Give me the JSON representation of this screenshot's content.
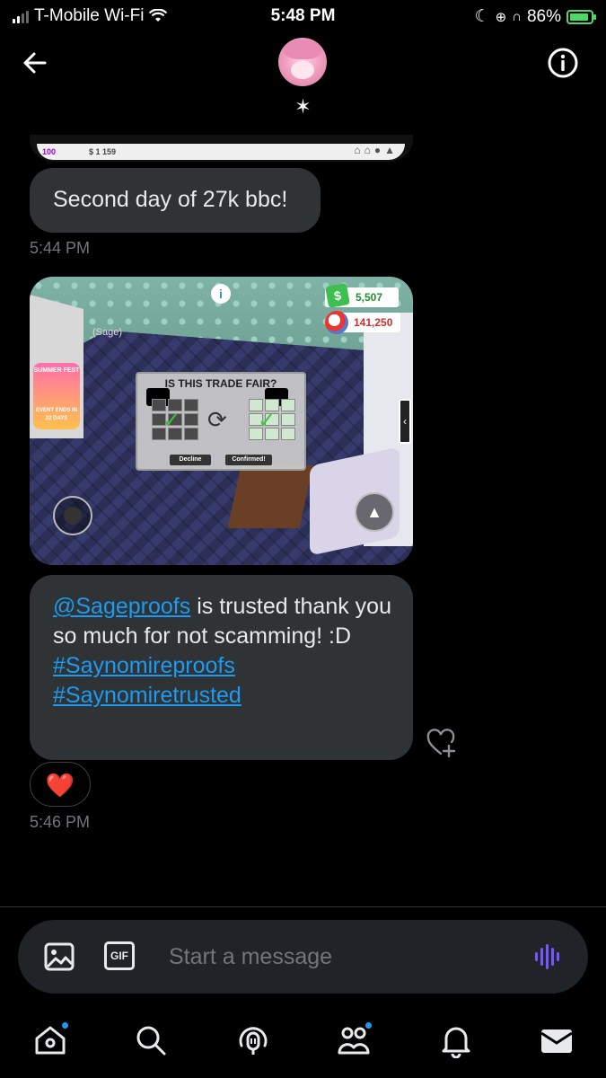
{
  "status_bar": {
    "carrier": "T-Mobile Wi-Fi",
    "time": "5:48 PM",
    "battery": "86%"
  },
  "header": {
    "star_symbol": "✶"
  },
  "top_image": {
    "text_left": "100",
    "text_price": "$ 1 159"
  },
  "messages": [
    {
      "text": "Second day of 27k bbc!",
      "time": "5:44 PM"
    },
    {
      "image": {
        "money": "5,507",
        "bucks": "141,250",
        "player_name": "(Sage)",
        "event_badge": "SUMMER FEST",
        "event_sub": "EVENT ENDS IN 22 DAYS",
        "trade_title": "IS THIS TRADE FAIR?",
        "decline_label": "Decline",
        "confirmed_label": "Confirmed!"
      }
    },
    {
      "mention": "@Sageproofs",
      "text_line1": " is trusted thank you so much for not scamming! :D",
      "hashtag1": "#Saynomireproofs",
      "hashtag2": "#Saynomiretrusted",
      "reaction": "❤️",
      "time": "5:46 PM"
    }
  ],
  "composer": {
    "gif_label": "GIF",
    "placeholder": "Start a message"
  },
  "colors": {
    "background": "#000000",
    "bubble": "#2f3336",
    "accent": "#1d9bf0",
    "muted": "#71767b",
    "voice": "#7856ff"
  },
  "icons": [
    "back-arrow-icon",
    "info-icon",
    "photo-icon",
    "gif-icon",
    "voice-icon",
    "home-icon",
    "search-icon",
    "spaces-icon",
    "communities-icon",
    "bell-icon",
    "mail-icon",
    "heart-plus-icon"
  ]
}
